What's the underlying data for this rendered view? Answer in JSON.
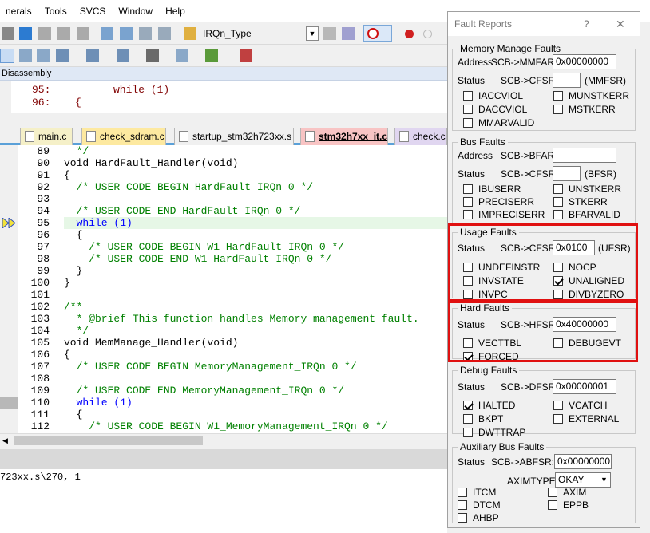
{
  "menubar": [
    "nerals",
    "Tools",
    "SVCS",
    "Window",
    "Help"
  ],
  "toolbar": {
    "target_combo": "IRQn_Type"
  },
  "disassembly": {
    "title": "Disassembly",
    "lines": [
      {
        "num": "95:",
        "code": "while (1)"
      },
      {
        "num": "96:",
        "code": "{"
      }
    ]
  },
  "tabs": [
    "main.c",
    "check_sdram.c",
    "startup_stm32h723xx.s",
    "stm32h7xx_it.c",
    "check.c"
  ],
  "editor_lines": [
    {
      "n": "89",
      "t": "  */",
      "c": "cm"
    },
    {
      "n": "90",
      "t": "void HardFault_Handler(void)",
      "c": "fn"
    },
    {
      "n": "91",
      "t": "{",
      "c": ""
    },
    {
      "n": "92",
      "t": "  /* USER CODE BEGIN HardFault_IRQn 0 */",
      "c": "cm"
    },
    {
      "n": "93",
      "t": "",
      "c": ""
    },
    {
      "n": "94",
      "t": "  /* USER CODE END HardFault_IRQn 0 */",
      "c": "cm"
    },
    {
      "n": "95",
      "t": "  while (1)",
      "c": "kw"
    },
    {
      "n": "96",
      "t": "  {",
      "c": ""
    },
    {
      "n": "97",
      "t": "    /* USER CODE BEGIN W1_HardFault_IRQn 0 */",
      "c": "cm"
    },
    {
      "n": "98",
      "t": "    /* USER CODE END W1_HardFault_IRQn 0 */",
      "c": "cm"
    },
    {
      "n": "99",
      "t": "  }",
      "c": ""
    },
    {
      "n": "100",
      "t": "}",
      "c": ""
    },
    {
      "n": "101",
      "t": "",
      "c": ""
    },
    {
      "n": "102",
      "t": "/**",
      "c": "cm"
    },
    {
      "n": "103",
      "t": "  * @brief This function handles Memory management fault.",
      "c": "cm"
    },
    {
      "n": "104",
      "t": "  */",
      "c": "cm"
    },
    {
      "n": "105",
      "t": "void MemManage_Handler(void)",
      "c": "fn"
    },
    {
      "n": "106",
      "t": "{",
      "c": ""
    },
    {
      "n": "107",
      "t": "  /* USER CODE BEGIN MemoryManagement_IRQn 0 */",
      "c": "cm"
    },
    {
      "n": "108",
      "t": "",
      "c": ""
    },
    {
      "n": "109",
      "t": "  /* USER CODE END MemoryManagement_IRQn 0 */",
      "c": "cm"
    },
    {
      "n": "110",
      "t": "  while (1)",
      "c": "kw"
    },
    {
      "n": "111",
      "t": "  {",
      "c": ""
    },
    {
      "n": "112",
      "t": "    /* USER CODE BEGIN W1_MemoryManagement_IRQn 0 */",
      "c": "cm"
    }
  ],
  "status_line": "723xx.s\\270, 1",
  "fault_reports": {
    "title": "Fault Reports",
    "help": "?",
    "close": "✕",
    "mem": {
      "label": "Memory Manage Faults",
      "address_label": "Address",
      "mmfar_label": "SCB->MMFAR:",
      "mmfar_value": "0x00000000",
      "status_label": "Status",
      "cfsr_label": "SCB->CFSR:",
      "cfsr_value": "",
      "cfsr_unit": "(MMFSR)",
      "flags": [
        {
          "name": "IACCVIOL",
          "checked": false
        },
        {
          "name": "MUNSTKERR",
          "checked": false
        },
        {
          "name": "DACCVIOL",
          "checked": false
        },
        {
          "name": "MSTKERR",
          "checked": false
        },
        {
          "name": "MMARVALID",
          "checked": false
        }
      ]
    },
    "bus": {
      "label": "Bus Faults",
      "address_label": "Address",
      "bfar_label": "SCB->BFAR:",
      "bfar_value": "",
      "status_label": "Status",
      "cfsr_label": "SCB->CFSR:",
      "cfsr_value": "",
      "cfsr_unit": "(BFSR)",
      "flags": [
        {
          "name": "IBUSERR",
          "checked": false
        },
        {
          "name": "UNSTKERR",
          "checked": false
        },
        {
          "name": "PRECISERR",
          "checked": false
        },
        {
          "name": "STKERR",
          "checked": false
        },
        {
          "name": "IMPRECISERR",
          "checked": false
        },
        {
          "name": "BFARVALID",
          "checked": false
        }
      ]
    },
    "usage": {
      "label": "Usage Faults",
      "status_label": "Status",
      "cfsr_label": "SCB->CFSR:",
      "cfsr_value": "0x0100",
      "cfsr_unit": "(UFSR)",
      "flags": [
        {
          "name": "UNDEFINSTR",
          "checked": false
        },
        {
          "name": "NOCP",
          "checked": false
        },
        {
          "name": "INVSTATE",
          "checked": false
        },
        {
          "name": "UNALIGNED",
          "checked": true
        },
        {
          "name": "INVPC",
          "checked": false
        },
        {
          "name": "DIVBYZERO",
          "checked": false
        }
      ]
    },
    "hard": {
      "label": "Hard Faults",
      "status_label": "Status",
      "hfsr_label": "SCB->HFSR:",
      "hfsr_value": "0x40000000",
      "flags": [
        {
          "name": "VECTTBL",
          "checked": false
        },
        {
          "name": "DEBUGEVT",
          "checked": false
        },
        {
          "name": "FORCED",
          "checked": true
        }
      ]
    },
    "debug": {
      "label": "Debug Faults",
      "status_label": "Status",
      "dfsr_label": "SCB->DFSR:",
      "dfsr_value": "0x00000001",
      "flags": [
        {
          "name": "HALTED",
          "checked": true
        },
        {
          "name": "VCATCH",
          "checked": false
        },
        {
          "name": "BKPT",
          "checked": false
        },
        {
          "name": "EXTERNAL",
          "checked": false
        },
        {
          "name": "DWTTRAP",
          "checked": false
        }
      ]
    },
    "aux": {
      "label": "Auxiliary Bus Faults",
      "status_label": "Status",
      "abfsr_label": "SCB->ABFSR:",
      "abfsr_value": "0x00000000",
      "aximtype_label": "AXIMTYPE:",
      "aximtype_value": "OKAY",
      "flags": [
        {
          "name": "ITCM",
          "checked": false
        },
        {
          "name": "AXIM",
          "checked": false
        },
        {
          "name": "DTCM",
          "checked": false
        },
        {
          "name": "EPPB",
          "checked": false
        },
        {
          "name": "AHBP",
          "checked": false
        }
      ]
    }
  },
  "colors": {
    "highlight": "#e01010",
    "current_line": "#e6f7e6",
    "tab_active": "#f8c4c4",
    "tab_yellow": "#fff0a8"
  }
}
